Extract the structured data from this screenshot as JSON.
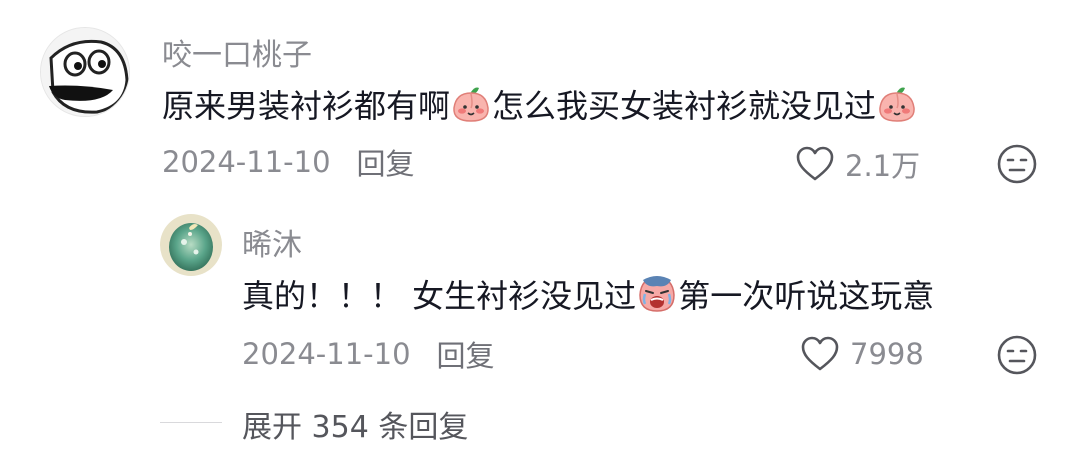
{
  "comment": {
    "username": "咬一口桃子",
    "text_part1": "原来男装衬衫都有啊",
    "emoji_1": "peach-smile-emoji",
    "text_part2": "怎么我买女装衬衫就没见过",
    "emoji_2": "peach-smile-emoji",
    "date": "2024-11-10",
    "reply_label": "回复",
    "like_count": "2.1万"
  },
  "reply": {
    "username": "晞沐",
    "text_part1": "真的！！！ 女生衬衫没见过",
    "emoji_1": "crying-face-emoji",
    "text_part2": "第一次听说这玩意",
    "date": "2024-11-10",
    "reply_label": "回复",
    "like_count": "7998"
  },
  "expand": {
    "label": "展开 354 条回复"
  },
  "colors": {
    "username": "#8a8b91",
    "text": "#161823",
    "meta": "#8a8b91",
    "peach": "#f7a2a0",
    "leaf": "#3fa34d"
  }
}
